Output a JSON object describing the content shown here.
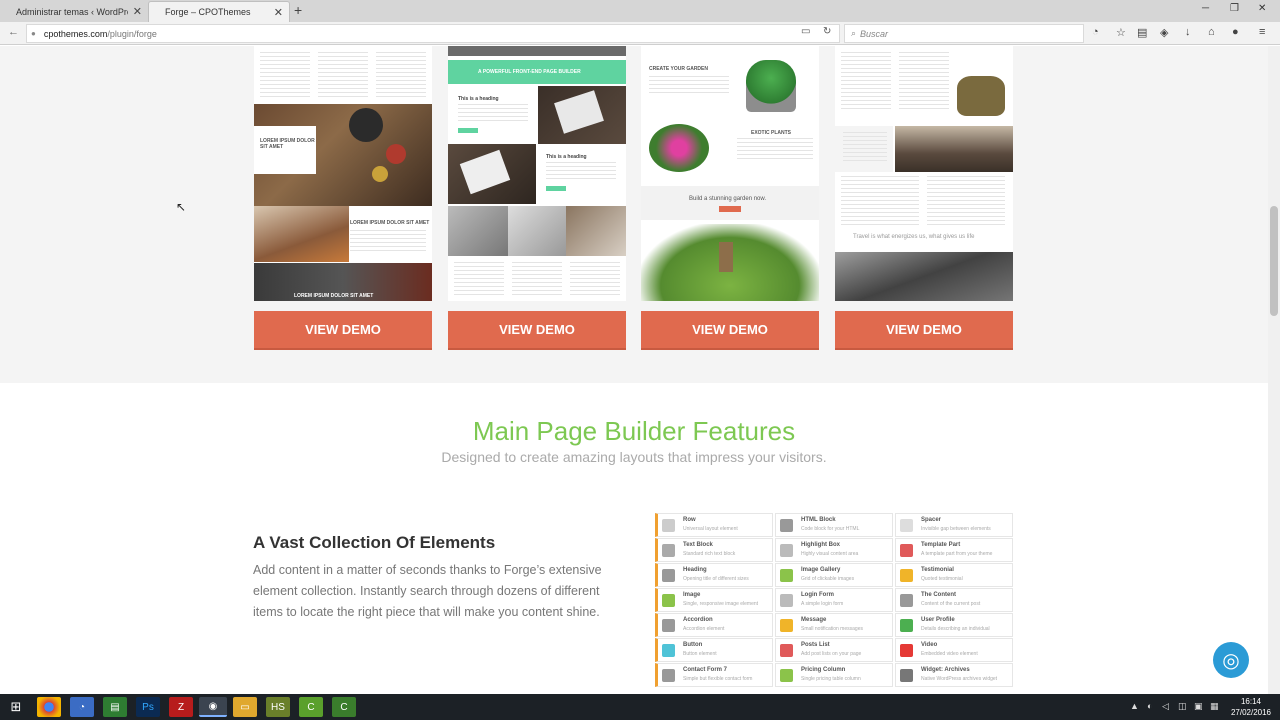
{
  "browser": {
    "tabs": [
      {
        "label": "Administrar temas ‹ WordPres…",
        "active": false
      },
      {
        "label": "Forge – CPOThemes",
        "active": true
      }
    ],
    "url_host": "cpothemes.com",
    "url_path": "/plugin/forge",
    "search_placeholder": "Buscar"
  },
  "demos": {
    "button_label": "VIEW DEMO",
    "thumbnails": [
      {
        "headline1": "LOREM IPSUM DOLOR SIT AMET",
        "headline2": "LOREM IPSUM DOLOR SIT AMET",
        "footer": "LOREM IPSUM DOLOR SIT AMET"
      },
      {
        "banner": "A POWERFUL FRONT-END PAGE BUILDER",
        "heading1": "This is a heading",
        "heading2": "This is a heading"
      },
      {
        "title": "CREATE YOUR GARDEN",
        "subtitle": "EXOTIC PLANTS",
        "cta": "Build a stunning garden now."
      },
      {
        "quote": "Travel is what energizes us, what gives us life"
      }
    ]
  },
  "features": {
    "title": "Main Page Builder Features",
    "subtitle": "Designed to create amazing layouts that impress your visitors."
  },
  "elements_section": {
    "title": "A Vast Collection Of Elements",
    "description": "Add content in a matter of seconds thanks to Forge’s extensive element collection. Instantly search through dozens of different items to locate the right piece that will make you content shine."
  },
  "element_grid": [
    {
      "name": "Row",
      "desc": "Universal layout element",
      "icon_color": "#cccccc"
    },
    {
      "name": "HTML Block",
      "desc": "Code block for your HTML",
      "icon_color": "#999999"
    },
    {
      "name": "Spacer",
      "desc": "Invisible gap between elements",
      "icon_color": "#dddddd"
    },
    {
      "name": "Text Block",
      "desc": "Standard rich text block",
      "icon_color": "#aaaaaa"
    },
    {
      "name": "Highlight Box",
      "desc": "Highly visual content area",
      "icon_color": "#bbbbbb"
    },
    {
      "name": "Template Part",
      "desc": "A template part from your theme",
      "icon_color": "#e05a5a"
    },
    {
      "name": "Heading",
      "desc": "Opening title of different sizes",
      "icon_color": "#999999"
    },
    {
      "name": "Image Gallery",
      "desc": "Grid of clickable images",
      "icon_color": "#8bc34a"
    },
    {
      "name": "Testimonial",
      "desc": "Quoted testimonial",
      "icon_color": "#f0b429"
    },
    {
      "name": "Image",
      "desc": "Single, responsive image element",
      "icon_color": "#8bc34a"
    },
    {
      "name": "Login Form",
      "desc": "A simple login form",
      "icon_color": "#bbbbbb"
    },
    {
      "name": "The Content",
      "desc": "Content of the current post",
      "icon_color": "#999999"
    },
    {
      "name": "Accordion",
      "desc": "Accordion element",
      "icon_color": "#999999"
    },
    {
      "name": "Message",
      "desc": "Small notification messages",
      "icon_color": "#f0b429"
    },
    {
      "name": "User Profile",
      "desc": "Details describing an individual",
      "icon_color": "#4caf50"
    },
    {
      "name": "Button",
      "desc": "Button element",
      "icon_color": "#4fc3d7"
    },
    {
      "name": "Posts List",
      "desc": "Add post lists on your page",
      "icon_color": "#e05a5a"
    },
    {
      "name": "Video",
      "desc": "Embedded video element",
      "icon_color": "#e53935"
    },
    {
      "name": "Contact Form 7",
      "desc": "Simple but flexible contact form",
      "icon_color": "#999999"
    },
    {
      "name": "Pricing Column",
      "desc": "Single pricing table column",
      "icon_color": "#8bc34a"
    },
    {
      "name": "Widget: Archives",
      "desc": "Native WordPress archives widget",
      "icon_color": "#777777"
    }
  ],
  "taskbar": {
    "time": "16:14",
    "date": "27/02/2016"
  },
  "colors": {
    "accent_orange": "#e06a4e",
    "feature_green": "#7dc852",
    "help_blue": "#2b9bd6"
  }
}
